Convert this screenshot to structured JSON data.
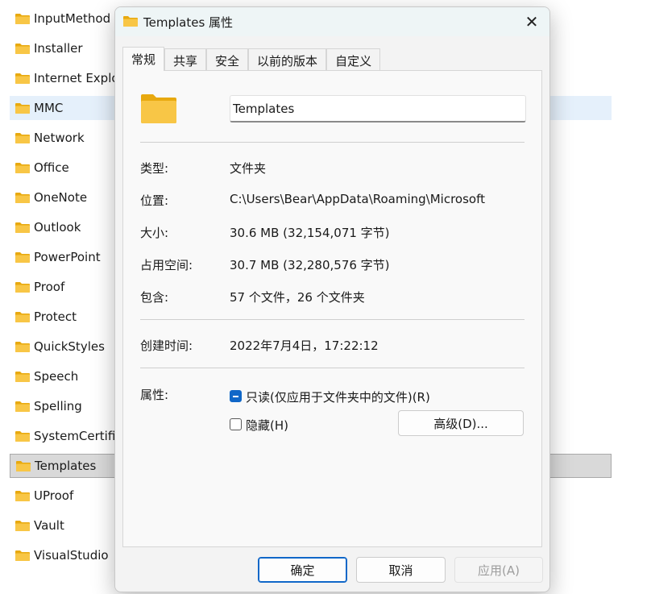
{
  "file_list": [
    "InputMethod",
    "Installer",
    "Internet Explo",
    "MMC",
    "Network",
    "Office",
    "OneNote",
    "Outlook",
    "PowerPoint",
    "Proof",
    "Protect",
    "QuickStyles",
    "Speech",
    "Spelling",
    "SystemCertific",
    "Templates",
    "UProof",
    "Vault",
    "VisualStudio"
  ],
  "dialog": {
    "title": "Templates 属性",
    "close_glyph": "✕",
    "tabs": [
      "常规",
      "共享",
      "安全",
      "以前的版本",
      "自定义"
    ],
    "name_value": "Templates",
    "properties": [
      {
        "label": "类型:",
        "value": "文件夹"
      },
      {
        "label": "位置:",
        "value": "C:\\Users\\Bear\\AppData\\Roaming\\Microsoft"
      },
      {
        "label": "大小:",
        "value": "30.6 MB (32,154,071 字节)"
      },
      {
        "label": "占用空间:",
        "value": "30.7 MB (32,280,576 字节)"
      },
      {
        "label": "包含:",
        "value": "57 个文件，26 个文件夹"
      }
    ],
    "created_label": "创建时间:",
    "created_value": "2022年7月4日，17:22:12",
    "attributes_label": "属性:",
    "readonly_label": "只读(仅应用于文件夹中的文件)(R)",
    "hidden_label": "隐藏(H)",
    "advanced_button": "高级(D)...",
    "ok_button": "确定",
    "cancel_button": "取消",
    "apply_button": "应用(A)"
  },
  "colors": {
    "accent": "#1067c8",
    "folder_yellow": "#f8c646"
  }
}
